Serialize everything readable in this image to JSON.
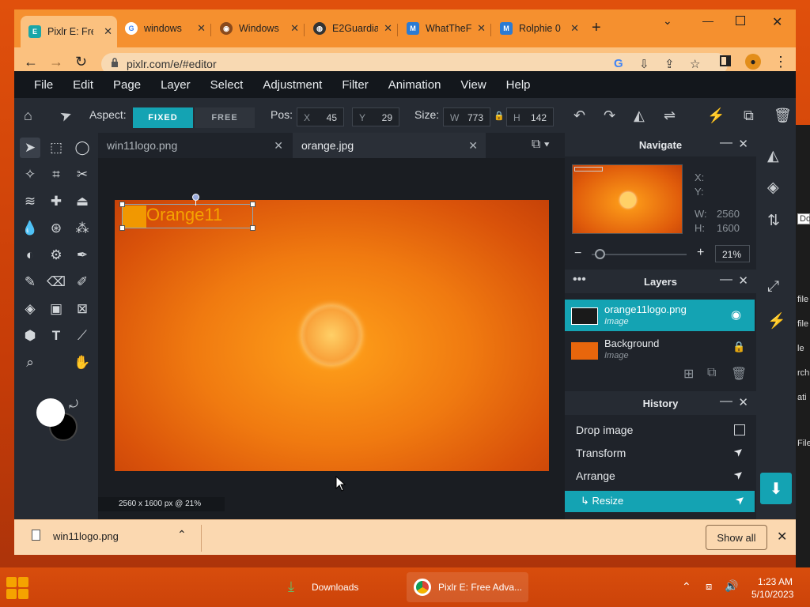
{
  "browser": {
    "tabs": [
      {
        "title": "Pixlr E: Free",
        "icon": "pixlr-icon",
        "color": "#1aa6a8"
      },
      {
        "title": "windows",
        "icon": "google-icon",
        "color": "#4285f4"
      },
      {
        "title": "Windows",
        "icon": "windows-site-icon",
        "color": "#8a4a1c"
      },
      {
        "title": "E2Guardia",
        "icon": "globe-icon",
        "color": "#333333"
      },
      {
        "title": "WhatTheF",
        "icon": "whatthefont-icon",
        "color": "#2b7bd3"
      },
      {
        "title": "Rolphie 0",
        "icon": "rolphie-icon",
        "color": "#2b7bd3"
      }
    ],
    "url": "pixlr.com/e/#editor"
  },
  "menu": [
    "File",
    "Edit",
    "Page",
    "Layer",
    "Select",
    "Adjustment",
    "Filter",
    "Animation",
    "View",
    "Help"
  ],
  "options": {
    "aspect_label": "Aspect:",
    "fixed": "FIXED",
    "free": "FREE",
    "pos_label": "Pos:",
    "x_key": "X",
    "x_val": "45",
    "y_key": "Y",
    "y_val": "29",
    "size_label": "Size:",
    "w_key": "W",
    "w_val": "773",
    "h_key": "H",
    "h_val": "142"
  },
  "docs": {
    "tab1": "win11logo.png",
    "tab2": "orange.jpg",
    "logo_text": "Orange11",
    "status": "2560 x 1600 px @ 21%"
  },
  "navigate": {
    "title": "Navigate",
    "x_label": "X:",
    "y_label": "Y:",
    "w_label": "W:",
    "w_val": "2560",
    "h_label": "H:",
    "h_val": "1600",
    "zoom": "21%"
  },
  "layers": {
    "title": "Layers",
    "items": [
      {
        "name": "orange11logo.png",
        "type": "Image"
      },
      {
        "name": "Background",
        "type": "Image"
      }
    ]
  },
  "history": {
    "title": "History",
    "items": [
      "Drop image",
      "Transform",
      "Arrange",
      "↳ Resize"
    ]
  },
  "shelf": {
    "file": "win11logo.png",
    "show_all": "Show all"
  },
  "taskbar": {
    "downloads": "Downloads",
    "chrome": "Pixlr E: Free Adva...",
    "time": "1:23 AM",
    "date": "5/10/2023"
  },
  "background": {
    "rows": [
      "Do",
      "file",
      "file",
      "le",
      "rchi",
      "ati",
      "File"
    ]
  },
  "colors": {
    "accent": "#14a3b3",
    "app_bg": "#1f232a"
  }
}
